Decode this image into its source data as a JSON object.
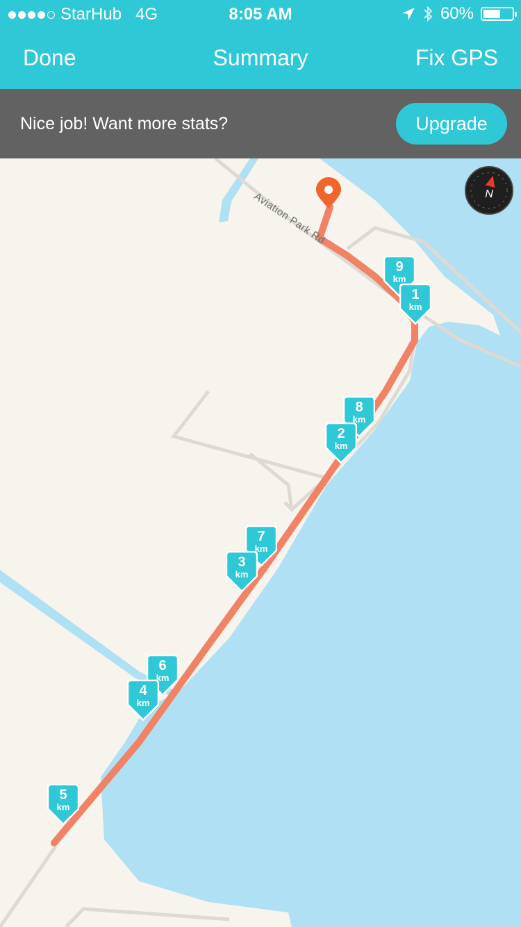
{
  "status_bar": {
    "carrier": "StarHub",
    "network": "4G",
    "time": "8:05 AM",
    "battery": "60%",
    "battery_level": 0.6,
    "signal_bars": 4,
    "signal_total": 5,
    "icons": [
      "location-arrow-icon",
      "bluetooth-icon",
      "battery-icon"
    ]
  },
  "nav": {
    "left_label": "Done",
    "title": "Summary",
    "right_label": "Fix GPS"
  },
  "banner": {
    "message": "Nice job! Want more stats?",
    "button_label": "Upgrade"
  },
  "map": {
    "road_label": "Aviation Park Rd",
    "compass_label": "N",
    "markers": [
      {
        "number": "1",
        "unit": "km"
      },
      {
        "number": "2",
        "unit": "km"
      },
      {
        "number": "3",
        "unit": "km"
      },
      {
        "number": "4",
        "unit": "km"
      },
      {
        "number": "5",
        "unit": "km"
      },
      {
        "number": "6",
        "unit": "km"
      },
      {
        "number": "7",
        "unit": "km"
      },
      {
        "number": "8",
        "unit": "km"
      },
      {
        "number": "9",
        "unit": "km"
      }
    ]
  },
  "colors": {
    "accent": "#2ec8d6",
    "banner": "#626262",
    "route": "#f08266",
    "water": "#afe0f3",
    "land": "#f7f4ee",
    "pin": "#f0652d"
  }
}
